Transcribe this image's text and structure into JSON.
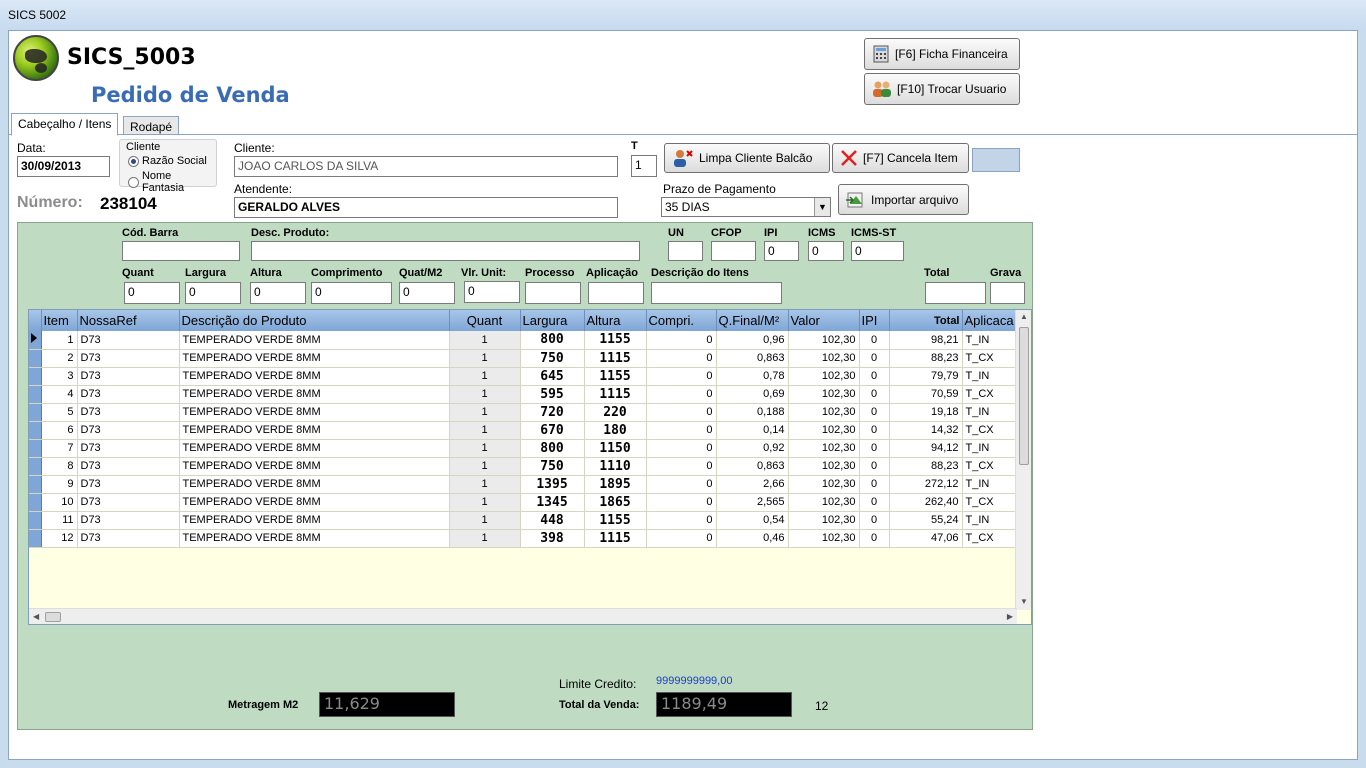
{
  "window": {
    "title": "SICS 5002"
  },
  "header": {
    "app_title": "SICS_5003",
    "page_title": "Pedido de Venda"
  },
  "buttons": {
    "ficha_financeira": "[F6] Ficha Financeira",
    "trocar_usuario": "[F10] Trocar Usuario",
    "limpa_cliente": "Limpa Cliente Balcão",
    "cancela_item": "[F7] Cancela Item",
    "importar_arquivo": "Importar arquivo"
  },
  "tabs": [
    {
      "label": "Cabeçalho / Itens"
    },
    {
      "label": "Rodapé"
    }
  ],
  "form": {
    "data_label": "Data:",
    "data_value": "30/09/2013",
    "cliente_group_label": "Cliente",
    "radio_razao": "Razão Social",
    "radio_fantasia": "Nome Fantasia",
    "cliente_label": "Cliente:",
    "cliente_value": "JOAO CARLOS DA SILVA",
    "t_label": "T",
    "t_value": "1",
    "atendente_label": "Atendente:",
    "atendente_value": "GERALDO ALVES",
    "prazo_label": "Prazo de Pagamento",
    "prazo_value": "35 DIAS",
    "numero_label": "Número:",
    "numero_value": "238104"
  },
  "item_entry": {
    "cod_barra": "Cód. Barra",
    "desc_produto": "Desc. Produto:",
    "un": "UN",
    "cfop": "CFOP",
    "ipi": "IPI",
    "icms": "ICMS",
    "icms_st": "ICMS-ST",
    "ipi_value": "0",
    "icms_value": "0",
    "icms_st_value": "0",
    "quant": "Quant",
    "largura": "Largura",
    "altura": "Altura",
    "comprimento": "Comprimento",
    "quat_m2": "Quat/M2",
    "vlr_unit": "Vlr. Unit:",
    "processo": "Processo",
    "aplicacao": "Aplicação",
    "desc_itens": "Descrição do Itens",
    "total": "Total",
    "grava": "Grava",
    "quant_value": "0",
    "largura_value": "0",
    "altura_value": "0",
    "comprimento_value": "0",
    "quat_m2_value": "0",
    "vlr_unit_value": "0"
  },
  "grid": {
    "columns": [
      "Item",
      "NossaRef",
      "Descrição do Produto",
      "Quant",
      "Largura",
      "Altura",
      "Compri.",
      "Q.Final/M²",
      "Valor",
      "IPI",
      "Total",
      "Aplicaca"
    ],
    "rows": [
      [
        "1",
        "D73",
        "TEMPERADO VERDE 8MM",
        "1",
        "800",
        "1155",
        "0",
        "0,96",
        "102,30",
        "0",
        "98,21",
        "T_IN"
      ],
      [
        "2",
        "D73",
        "TEMPERADO VERDE 8MM",
        "1",
        "750",
        "1115",
        "0",
        "0,863",
        "102,30",
        "0",
        "88,23",
        "T_CX"
      ],
      [
        "3",
        "D73",
        "TEMPERADO VERDE 8MM",
        "1",
        "645",
        "1155",
        "0",
        "0,78",
        "102,30",
        "0",
        "79,79",
        "T_IN"
      ],
      [
        "4",
        "D73",
        "TEMPERADO VERDE 8MM",
        "1",
        "595",
        "1115",
        "0",
        "0,69",
        "102,30",
        "0",
        "70,59",
        "T_CX"
      ],
      [
        "5",
        "D73",
        "TEMPERADO VERDE 8MM",
        "1",
        "720",
        "220",
        "0",
        "0,188",
        "102,30",
        "0",
        "19,18",
        "T_IN"
      ],
      [
        "6",
        "D73",
        "TEMPERADO VERDE 8MM",
        "1",
        "670",
        "180",
        "0",
        "0,14",
        "102,30",
        "0",
        "14,32",
        "T_CX"
      ],
      [
        "7",
        "D73",
        "TEMPERADO VERDE 8MM",
        "1",
        "800",
        "1150",
        "0",
        "0,92",
        "102,30",
        "0",
        "94,12",
        "T_IN"
      ],
      [
        "8",
        "D73",
        "TEMPERADO VERDE 8MM",
        "1",
        "750",
        "1110",
        "0",
        "0,863",
        "102,30",
        "0",
        "88,23",
        "T_CX"
      ],
      [
        "9",
        "D73",
        "TEMPERADO VERDE 8MM",
        "1",
        "1395",
        "1895",
        "0",
        "2,66",
        "102,30",
        "0",
        "272,12",
        "T_IN"
      ],
      [
        "10",
        "D73",
        "TEMPERADO VERDE 8MM",
        "1",
        "1345",
        "1865",
        "0",
        "2,565",
        "102,30",
        "0",
        "262,40",
        "T_CX"
      ],
      [
        "11",
        "D73",
        "TEMPERADO VERDE 8MM",
        "1",
        "448",
        "1155",
        "0",
        "0,54",
        "102,30",
        "0",
        "55,24",
        "T_IN"
      ],
      [
        "12",
        "D73",
        "TEMPERADO VERDE 8MM",
        "1",
        "398",
        "1115",
        "0",
        "0,46",
        "102,30",
        "0",
        "47,06",
        "T_CX"
      ]
    ]
  },
  "footer": {
    "limite_credito_label": "Limite Credito:",
    "limite_credito_value": "9999999999,00",
    "metragem_label": "Metragem M2",
    "metragem_value": "11,629",
    "total_venda_label": "Total da Venda:",
    "total_venda_value": "1189,49",
    "count": "12"
  },
  "colors": {
    "accent": "#3a6cb6",
    "panel_green": "#bfdcc3",
    "grid_header": "#7fa6d6",
    "grid_bg": "#ffffe4"
  }
}
